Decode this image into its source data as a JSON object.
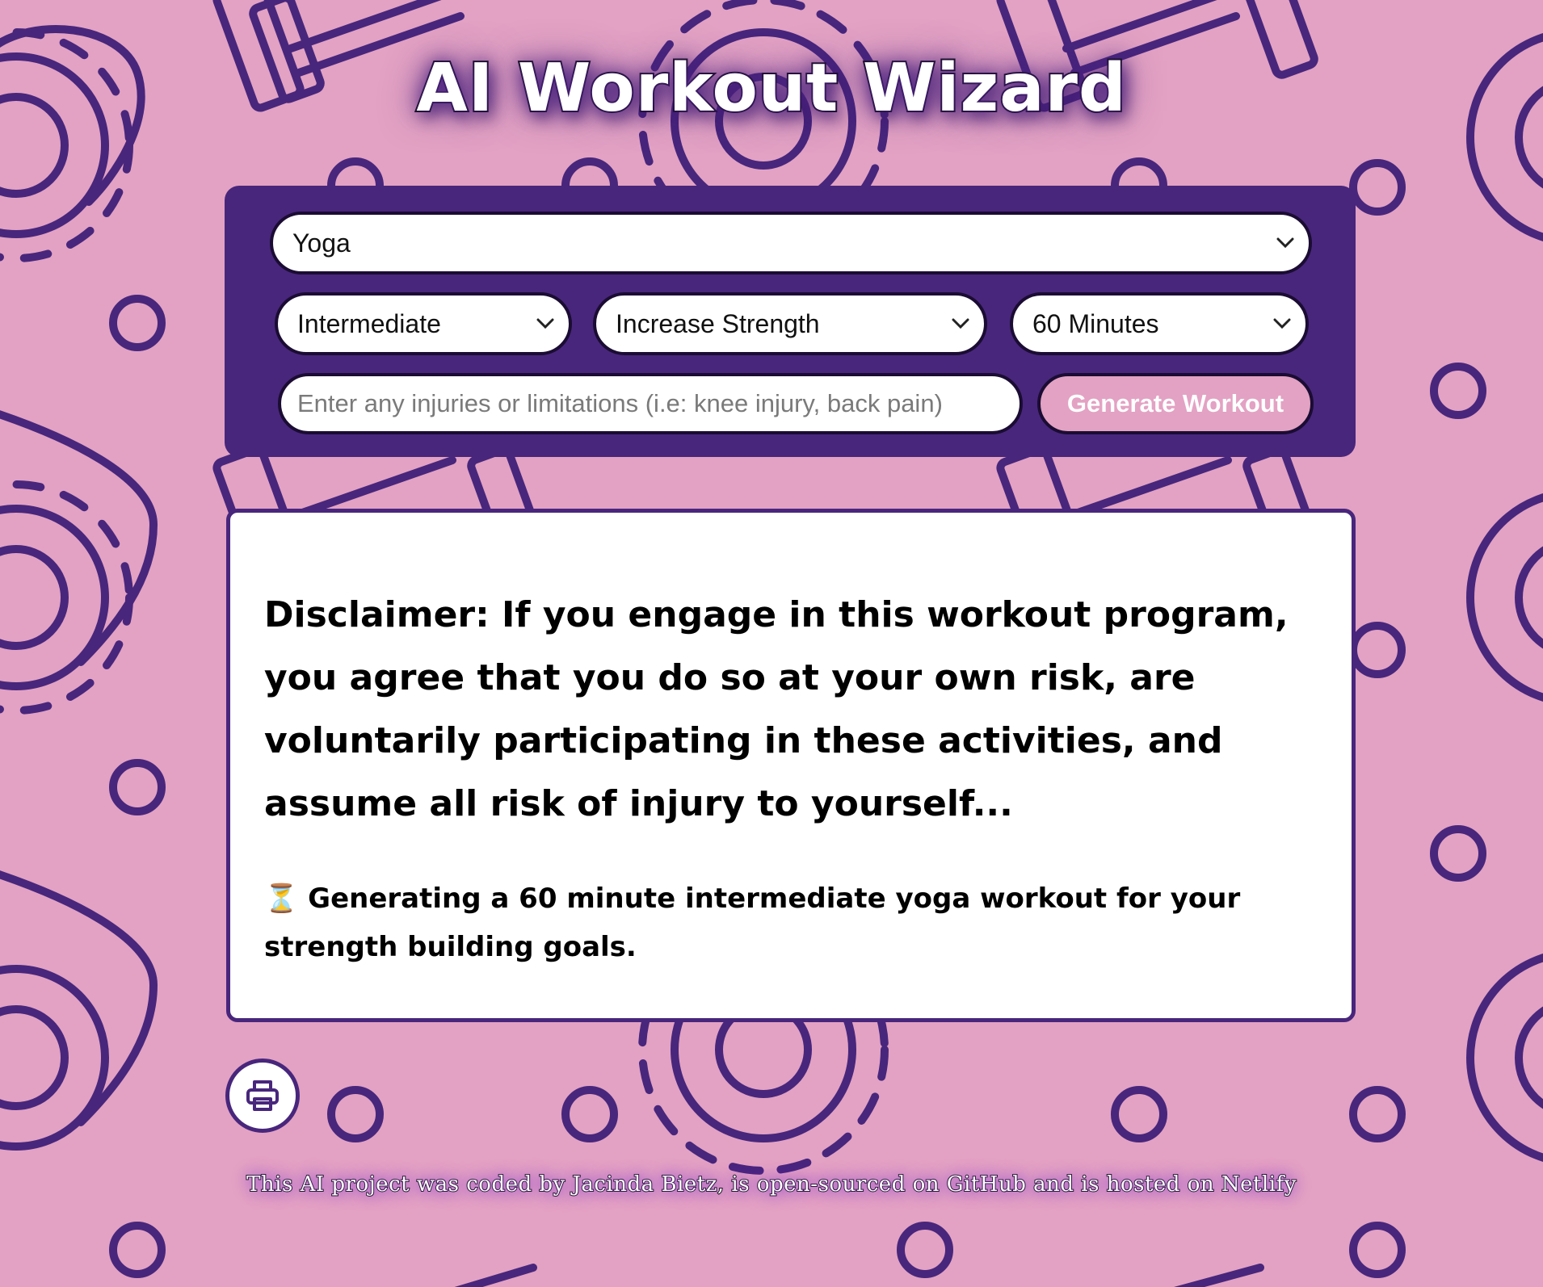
{
  "app": {
    "title": "AI Workout Wizard"
  },
  "form": {
    "workout_type": "Yoga",
    "level": "Intermediate",
    "goal": "Increase Strength",
    "duration": "60 Minutes",
    "injury_placeholder": "Enter any injuries or limitations (i.e: knee injury, back pain)",
    "generate_label": "Generate Workout"
  },
  "result": {
    "disclaimer": "Disclaimer: If you engage in this workout program, you agree that you do so at your own risk, are voluntarily participating in these activities, and assume all risk of injury to yourself...",
    "status": "⏳ Generating a 60 minute intermediate yoga workout for your strength building goals."
  },
  "footer": {
    "prefix": "This AI project was coded by ",
    "author": "Jacinda Bietz",
    "middle1": ", is ",
    "open_source": "open-sourced on GitHub",
    "middle2": " and is ",
    "hosted": "hosted on Netlify"
  },
  "icons": {
    "print": "printer-icon",
    "chevron": "chevron-down-icon"
  },
  "colors": {
    "background": "#e3a2c3",
    "accent": "#48267c",
    "button": "#e3a2c3"
  }
}
